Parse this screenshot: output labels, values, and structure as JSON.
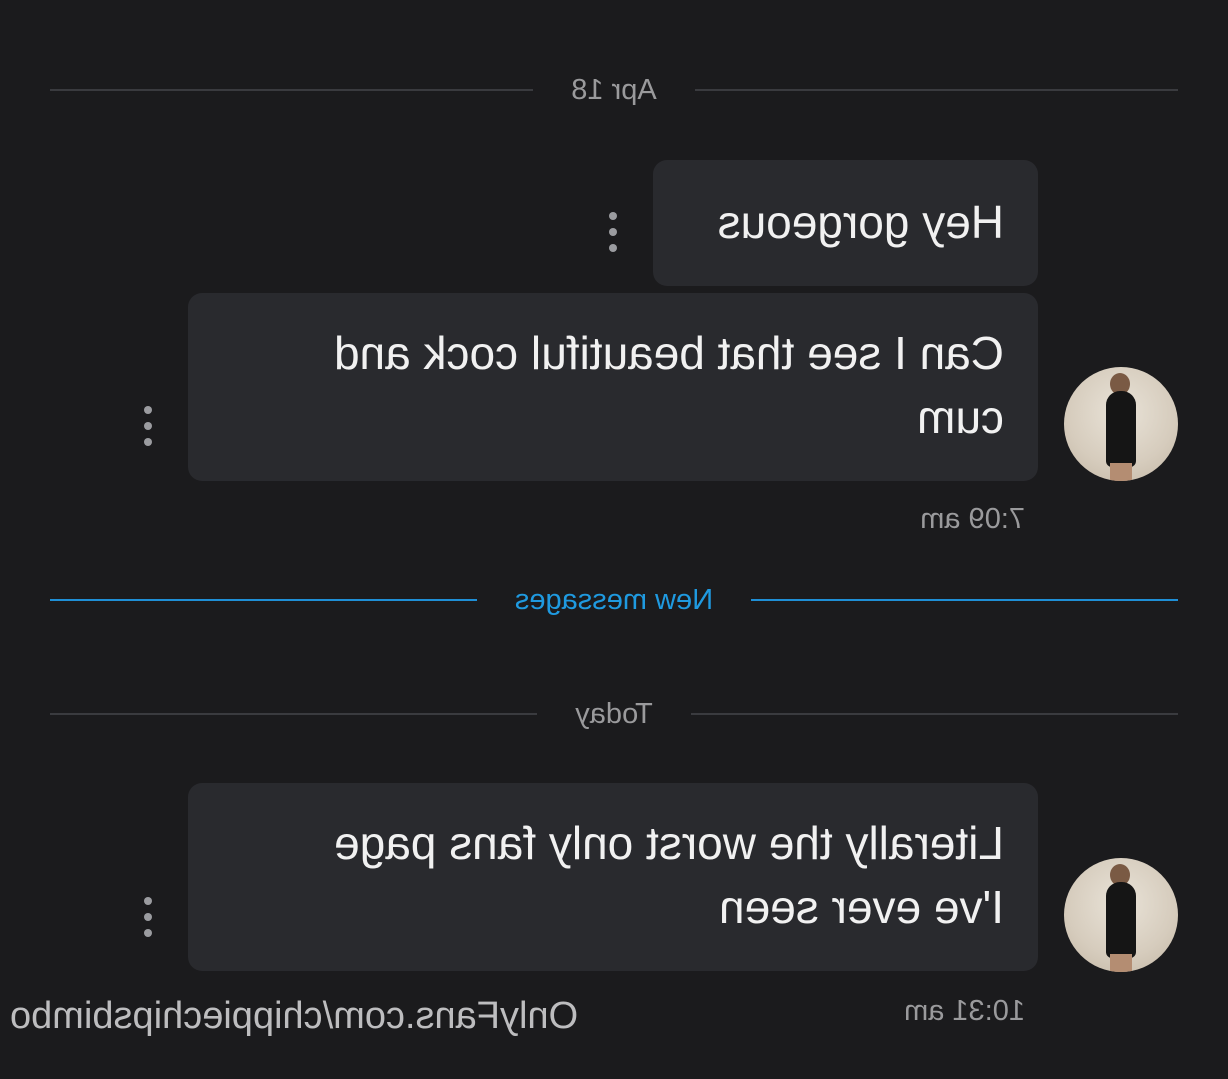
{
  "dividers": {
    "date_1": "Apr 18",
    "new_messages": "New messages",
    "date_2": "Today"
  },
  "messages": [
    {
      "text": "Hey gorgeous"
    },
    {
      "text_line1": "Can I see that beautiful cock and",
      "text_line2": "cum",
      "time": "7:09 am"
    },
    {
      "text_line1": "Literally the worst only fans page",
      "text_line2": "I've ever seen",
      "time": "10:31 am"
    }
  ],
  "icons": {
    "more": "more-vertical-icon",
    "avatar": "user-avatar"
  },
  "colors": {
    "background": "#1b1b1d",
    "bubble": "#292a2e",
    "accent": "#1f9ae0",
    "muted_text": "#9a9a9c"
  },
  "watermark": "OnlyFans.com/chippiechipsbimbo"
}
